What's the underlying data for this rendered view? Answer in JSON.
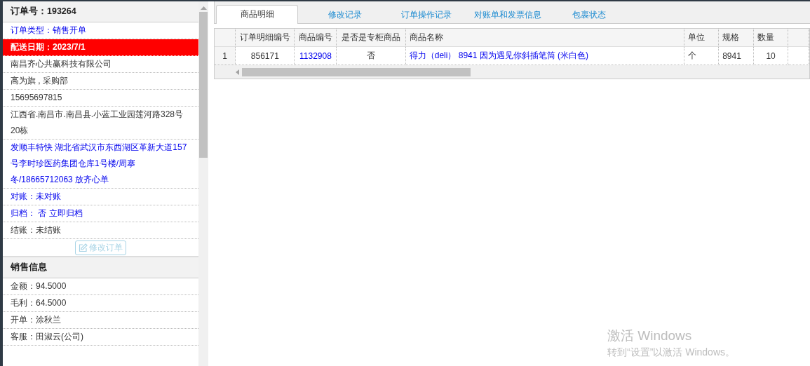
{
  "order_panel": {
    "title": "订单号：193264",
    "items": [
      {
        "kind": "link",
        "text": "订单类型：销售开单"
      },
      {
        "kind": "alert",
        "text": "配送日期：2023/7/1"
      },
      {
        "kind": "plain",
        "text": "南昌齐心共赢科技有限公司"
      },
      {
        "kind": "plain",
        "text": "高为旗 , 采购部"
      },
      {
        "kind": "plain",
        "text": "15695697815"
      },
      {
        "kind": "plain",
        "text": "江西省.南昌市.南昌县.小蓝工业园莲河路328号20栋"
      },
      {
        "kind": "link",
        "text": "发顺丰特快 湖北省武汉市东西湖区革新大道157号李时珍医药集团仓库1号楼/周搴冬/18665712063 放齐心单"
      },
      {
        "kind": "link",
        "text": "对账：未对账"
      },
      {
        "kind": "link",
        "text": "归档： 否 立即归档"
      },
      {
        "kind": "plain",
        "text": "结账：未结账"
      }
    ],
    "edit_button": {
      "label": "修改订单",
      "disabled": true
    },
    "sales_title": "销售信息",
    "sales_items": [
      "金额：94.5000",
      "毛利：64.5000",
      "开单：涂秋兰",
      "客服：田淑云(公司)"
    ]
  },
  "tabs": [
    {
      "label": "商品明细",
      "selected": true
    },
    {
      "label": "修改记录",
      "selected": false
    },
    {
      "label": "订单操作记录",
      "selected": false
    },
    {
      "label": "对账单和发票信息",
      "selected": false
    },
    {
      "label": "包裹状态",
      "selected": false
    }
  ],
  "table": {
    "columns": [
      "订单明细编号",
      "商品编号",
      "是否是专柜商品",
      "商品名称",
      "单位",
      "规格",
      "数量"
    ],
    "rows": [
      {
        "number": "1",
        "cells": [
          {
            "kind": "plain",
            "text": "856171"
          },
          {
            "kind": "link",
            "text": "1132908"
          },
          {
            "kind": "plain",
            "text": "否"
          },
          {
            "kind": "link",
            "text": "得力（deli） 8941 因为遇见你斜插笔筒 (米白色)"
          },
          {
            "kind": "plain",
            "text": "个"
          },
          {
            "kind": "plain",
            "text": "8941"
          },
          {
            "kind": "plain",
            "text": "10"
          }
        ]
      }
    ]
  },
  "system_overlay": {
    "title": "激活 Windows",
    "message": "转到“设置”以激活 Windows。"
  }
}
